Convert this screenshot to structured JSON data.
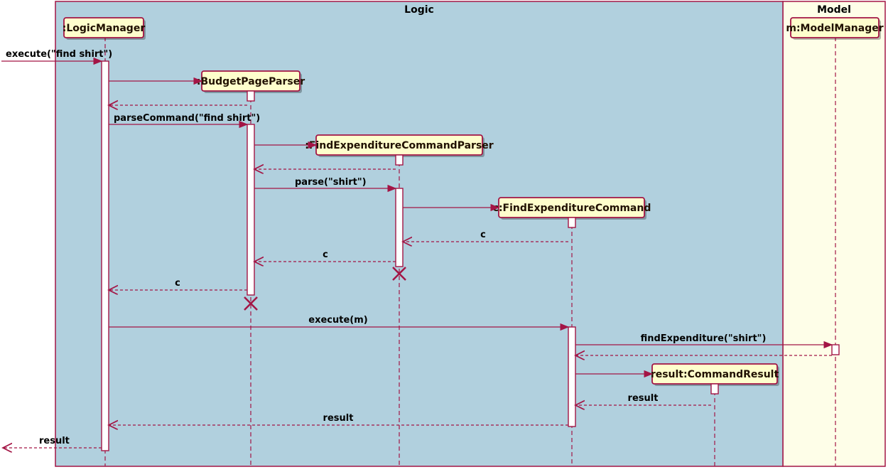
{
  "frames": {
    "logic": {
      "title": "Logic"
    },
    "model": {
      "title": "Model"
    }
  },
  "participants": {
    "logicManager": {
      "label": ":LogicManager"
    },
    "budgetPageParser": {
      "label": ":BudgetPageParser"
    },
    "findExpParser": {
      "label": ":FindExpenditureCommandParser"
    },
    "findExpCommand": {
      "label": "c:FindExpenditureCommand"
    },
    "commandResult": {
      "label": "result:CommandResult"
    },
    "modelManager": {
      "label": "m:ModelManager"
    }
  },
  "messages": {
    "m1": "execute(\"find shirt\")",
    "m2": "parseCommand(\"find shirt\")",
    "m3": "parse(\"shirt\")",
    "m4": "c",
    "m5": "c",
    "m6": "c",
    "m7": "execute(m)",
    "m8": "findExpenditure(\"shirt\")",
    "m9": "result",
    "m10": "result",
    "m11": "result"
  },
  "chart_data": {
    "type": "sequence-diagram",
    "frames": [
      {
        "name": "Logic",
        "participants": [
          "LogicManager",
          "BudgetPageParser",
          "FindExpenditureCommandParser",
          "c:FindExpenditureCommand",
          "result:CommandResult"
        ]
      },
      {
        "name": "Model",
        "participants": [
          "m:ModelManager"
        ]
      }
    ],
    "participants": [
      {
        "id": "LogicManager",
        "label": ":LogicManager"
      },
      {
        "id": "BudgetPageParser",
        "label": ":BudgetPageParser",
        "created_by": "LogicManager"
      },
      {
        "id": "FindExpenditureCommandParser",
        "label": ":FindExpenditureCommandParser",
        "created_by": "BudgetPageParser"
      },
      {
        "id": "FindExpenditureCommand",
        "label": "c:FindExpenditureCommand",
        "created_by": "FindExpenditureCommandParser"
      },
      {
        "id": "CommandResult",
        "label": "result:CommandResult",
        "created_by": "FindExpenditureCommand"
      },
      {
        "id": "ModelManager",
        "label": "m:ModelManager"
      }
    ],
    "messages": [
      {
        "from": "external",
        "to": "LogicManager",
        "type": "call",
        "label": "execute(\"find shirt\")"
      },
      {
        "from": "LogicManager",
        "to": "BudgetPageParser",
        "type": "create",
        "label": ""
      },
      {
        "from": "BudgetPageParser",
        "to": "LogicManager",
        "type": "return",
        "label": ""
      },
      {
        "from": "LogicManager",
        "to": "BudgetPageParser",
        "type": "call",
        "label": "parseCommand(\"find shirt\")"
      },
      {
        "from": "BudgetPageParser",
        "to": "FindExpenditureCommandParser",
        "type": "create",
        "label": ""
      },
      {
        "from": "FindExpenditureCommandParser",
        "to": "BudgetPageParser",
        "type": "return",
        "label": ""
      },
      {
        "from": "BudgetPageParser",
        "to": "FindExpenditureCommandParser",
        "type": "call",
        "label": "parse(\"shirt\")"
      },
      {
        "from": "FindExpenditureCommandParser",
        "to": "FindExpenditureCommand",
        "type": "create",
        "label": ""
      },
      {
        "from": "FindExpenditureCommand",
        "to": "FindExpenditureCommandParser",
        "type": "return",
        "label": "c"
      },
      {
        "from": "FindExpenditureCommandParser",
        "to": "BudgetPageParser",
        "type": "return",
        "label": "c"
      },
      {
        "from": "FindExpenditureCommandParser",
        "to": null,
        "type": "destroy",
        "label": ""
      },
      {
        "from": "BudgetPageParser",
        "to": "LogicManager",
        "type": "return",
        "label": "c"
      },
      {
        "from": "BudgetPageParser",
        "to": null,
        "type": "destroy",
        "label": ""
      },
      {
        "from": "LogicManager",
        "to": "FindExpenditureCommand",
        "type": "call",
        "label": "execute(m)"
      },
      {
        "from": "FindExpenditureCommand",
        "to": "ModelManager",
        "type": "call",
        "label": "findExpenditure(\"shirt\")"
      },
      {
        "from": "ModelManager",
        "to": "FindExpenditureCommand",
        "type": "return",
        "label": ""
      },
      {
        "from": "FindExpenditureCommand",
        "to": "CommandResult",
        "type": "create",
        "label": ""
      },
      {
        "from": "CommandResult",
        "to": "FindExpenditureCommand",
        "type": "return",
        "label": "result"
      },
      {
        "from": "FindExpenditureCommand",
        "to": "LogicManager",
        "type": "return",
        "label": "result"
      },
      {
        "from": "LogicManager",
        "to": "external",
        "type": "return",
        "label": "result"
      }
    ]
  }
}
